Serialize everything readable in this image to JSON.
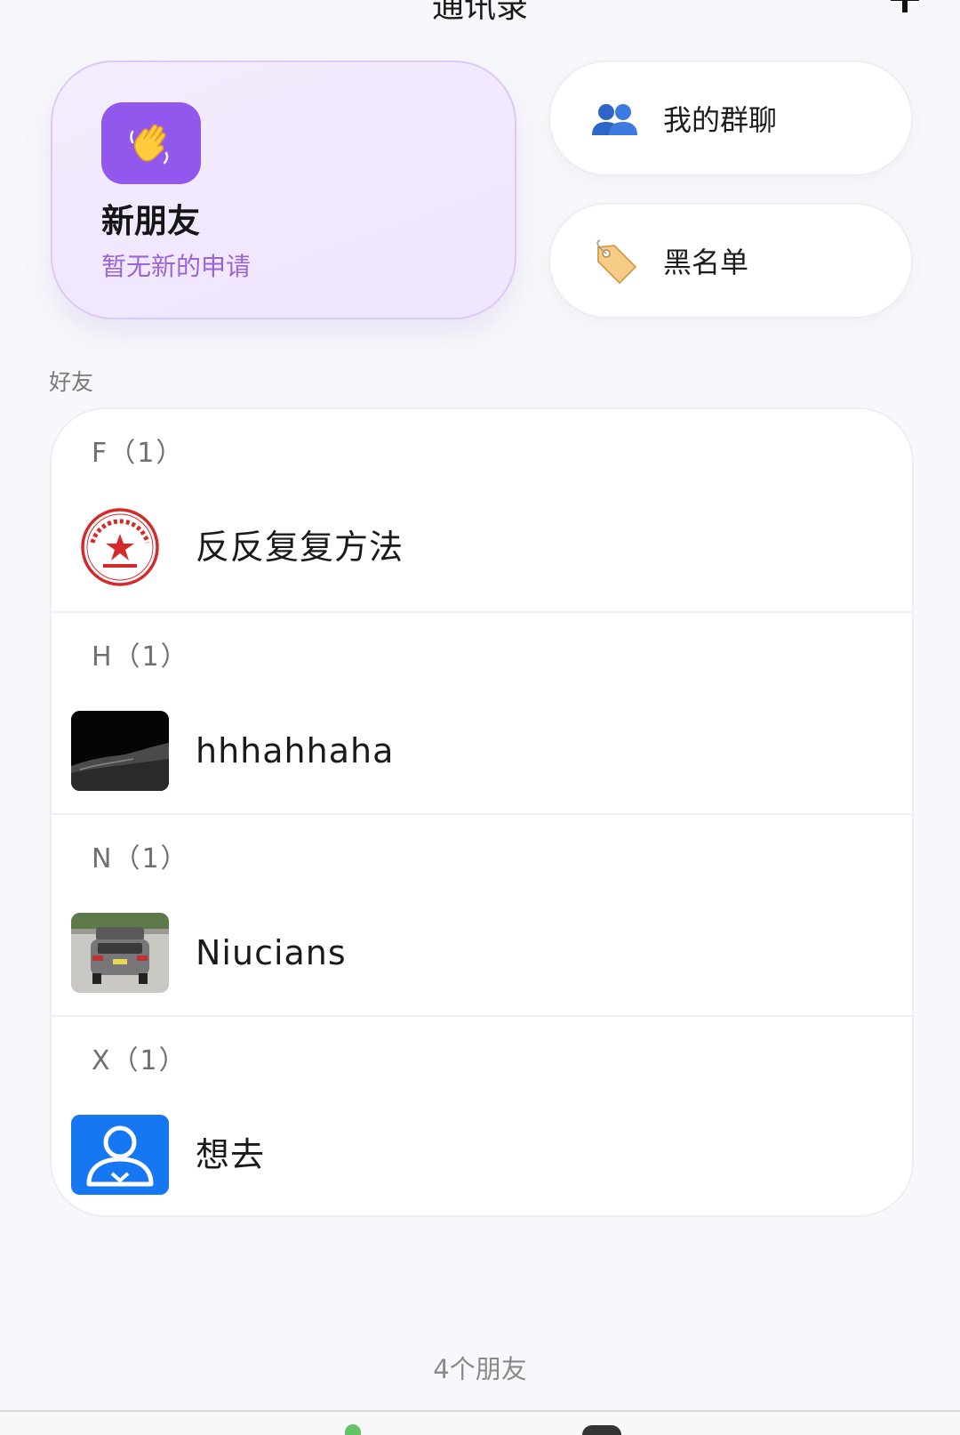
{
  "header": {
    "title": "通讯录",
    "add_icon": "plus-icon"
  },
  "new_friends": {
    "title": "新朋友",
    "subtitle": "暂无新的申请",
    "icon": "waving-hand-icon"
  },
  "quick_links": [
    {
      "label": "我的群聊",
      "icon": "group-icon"
    },
    {
      "label": "黑名单",
      "icon": "tag-icon"
    }
  ],
  "section_label": "好友",
  "groups": [
    {
      "letter": "F（1）",
      "contacts": [
        {
          "name": "反反复复方法",
          "avatar": "red-seal-avatar"
        }
      ]
    },
    {
      "letter": "H（1）",
      "contacts": [
        {
          "name": "hhhahhaha",
          "avatar": "dark-landscape-avatar"
        }
      ]
    },
    {
      "letter": "N（1）",
      "contacts": [
        {
          "name": "Niucians",
          "avatar": "car-photo-avatar"
        }
      ]
    },
    {
      "letter": "X（1）",
      "contacts": [
        {
          "name": "想去",
          "avatar": "default-person-avatar"
        }
      ]
    }
  ],
  "footer": {
    "count_text": "4个朋友"
  },
  "colors": {
    "accent_purple": "#9257ec",
    "subtitle_purple": "#9b64d8",
    "default_avatar_blue": "#1677f2"
  }
}
